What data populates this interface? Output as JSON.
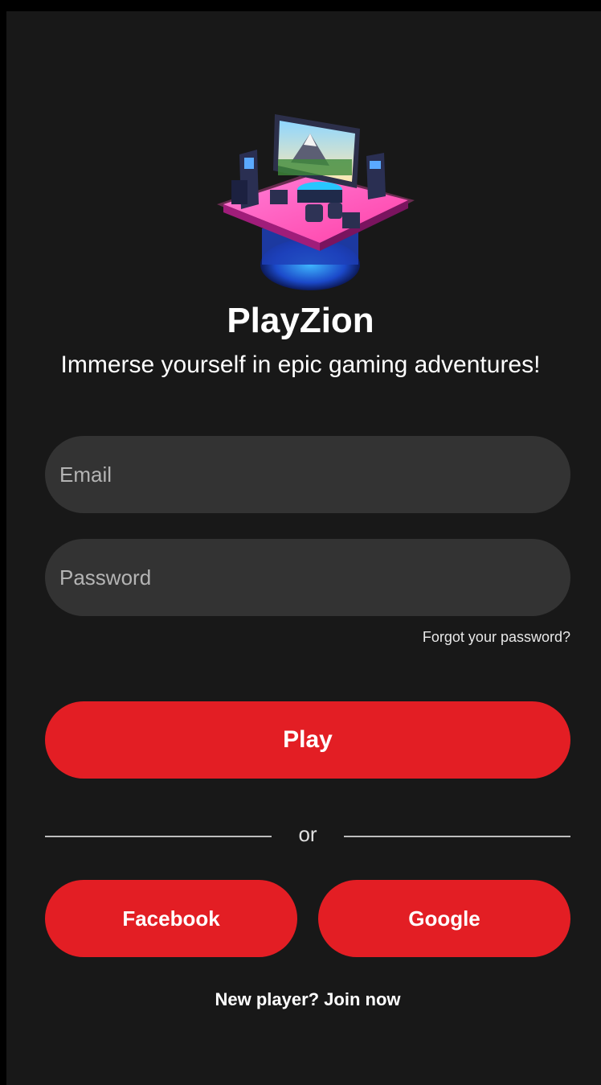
{
  "app": {
    "title": "PlayZion",
    "tagline": "Immerse yourself in epic gaming adventures!"
  },
  "form": {
    "email": {
      "value": "",
      "placeholder": "Email"
    },
    "password": {
      "value": "",
      "placeholder": "Password"
    },
    "forgot_label": "Forgot your password?"
  },
  "actions": {
    "play_label": "Play",
    "divider_label": "or",
    "facebook_label": "Facebook",
    "google_label": "Google",
    "join_label": "New player? Join now"
  },
  "icons": {
    "logo": "gaming-room-logo-icon"
  },
  "colors": {
    "background": "#181818",
    "field": "#333333",
    "accent": "#e31e24",
    "text": "#ffffff"
  }
}
